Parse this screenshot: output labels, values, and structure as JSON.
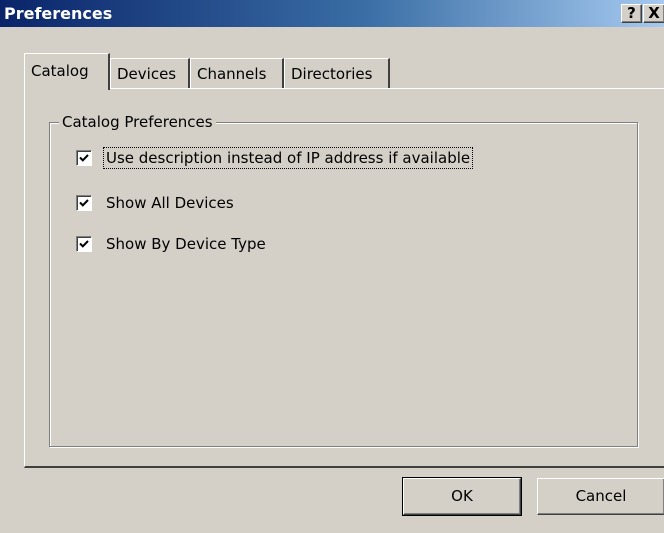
{
  "window": {
    "title": "Preferences",
    "help_label": "?",
    "close_label": "X"
  },
  "tabs": [
    {
      "label": "Catalog",
      "active": true
    },
    {
      "label": "Devices",
      "active": false
    },
    {
      "label": "Channels",
      "active": false
    },
    {
      "label": "Directories",
      "active": false
    }
  ],
  "group": {
    "legend": "Catalog Preferences",
    "options": [
      {
        "label": "Use description instead of IP address if available",
        "checked": true
      },
      {
        "label": "Show All Devices",
        "checked": true
      },
      {
        "label": "Show By Device Type",
        "checked": true
      }
    ]
  },
  "buttons": {
    "ok_label": "OK",
    "cancel_label": "Cancel"
  }
}
